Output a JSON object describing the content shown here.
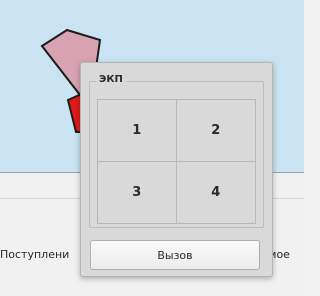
{
  "background": {
    "table_column_left": "Поступлени",
    "table_column_right": "имое"
  },
  "dialog": {
    "group_title": "ЭКП",
    "buttons": [
      "1",
      "2",
      "3",
      "4"
    ],
    "call_button": "Вызов"
  },
  "colors": {
    "canvas": "#c9e3f3",
    "shape_pink": "#d7a3b3",
    "shape_red": "#e01a1a"
  }
}
